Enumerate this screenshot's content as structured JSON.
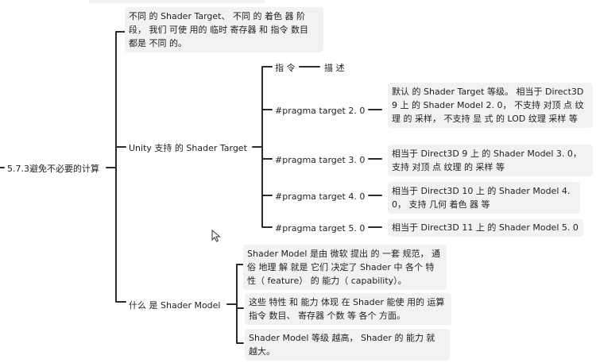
{
  "root": {
    "label": "5.7.3避免不必要的计算"
  },
  "intro": {
    "text": "不同 的 Shader Target、 不同 的 着色 器 阶 段， 我们 可使 用的 临时 寄存器 和 指令 数目 都是 不同 的。"
  },
  "unity": {
    "label": "Unity 支持 的 Shader Target",
    "header": {
      "left": "指 令",
      "right": "描 述"
    },
    "rows": [
      {
        "directive": "#pragma target 2. 0",
        "description": "默认 的 Shader Target 等级。 相当于 Direct3D 9 上 的 Shader Model 2. 0， 不支持 对顶 点 纹理 的 采样， 不支持 显 式 的 LOD 纹理 采样 等"
      },
      {
        "directive": "#pragma target 3. 0",
        "description": "相当于 Direct3D 9 上 的 Shader Model 3. 0， 支持 对顶 点 纹理 的 采样 等"
      },
      {
        "directive": "#pragma target 4. 0",
        "description": "相当于 Direct3D 10 上 的 Shader Model 4. 0， 支持 几何 着色 器 等"
      },
      {
        "directive": "#pragma target 5. 0",
        "description": "相当于 Direct3D 11 上 的 Shader Model 5. 0"
      }
    ]
  },
  "shader_model": {
    "label": "什么 是 Shader Model",
    "items": [
      "Shader Model 是由 微软 提出 的 一套 规范， 通俗 地理 解 就是 它们 决定了 Shader 中 各个 特性（ feature） 的 能力（ capability）。",
      "这些 特性 和 能力 体现 在 Shader 能使 用的 运算 指令 数目、 寄存器 个数 等 各个 方面。",
      "Shader Model 等级 越高， Shader 的 能力 就 越大。"
    ]
  },
  "colors": {
    "line": "#2b2b2b",
    "box": "#f2f2f2",
    "text": "#1f1f1f"
  }
}
